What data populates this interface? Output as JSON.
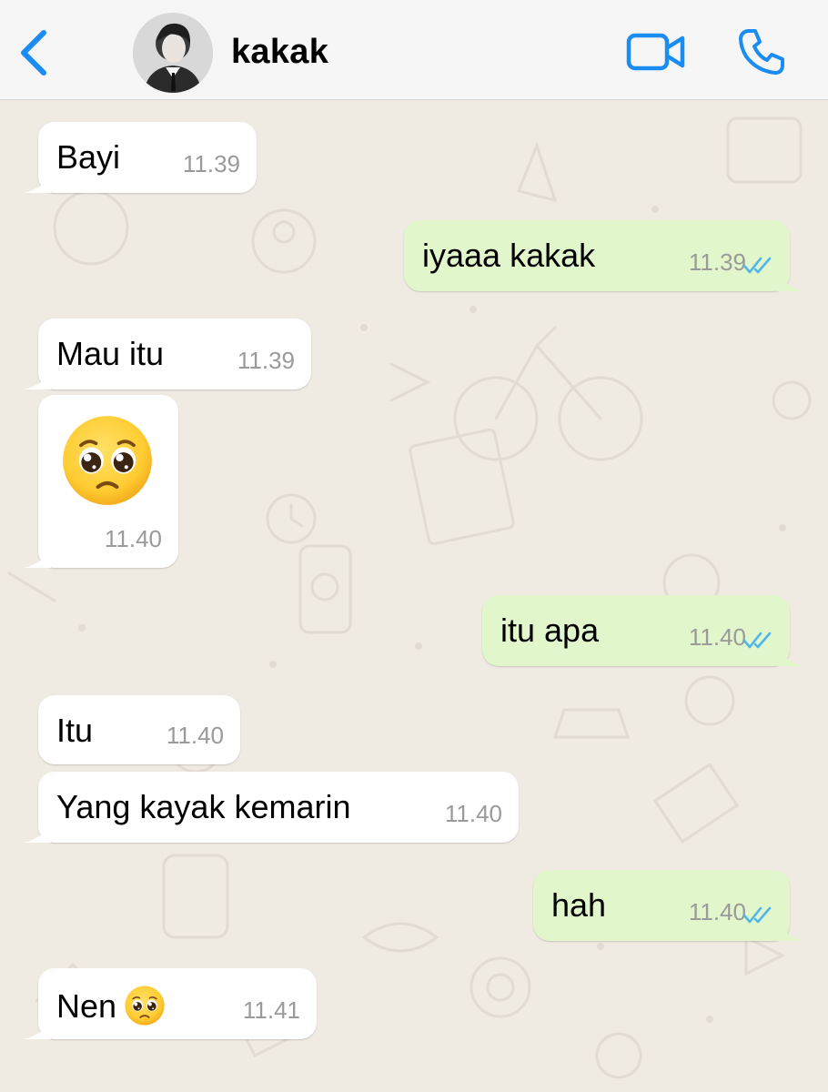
{
  "header": {
    "back_icon": "chevron-left-icon",
    "contact_name": "kakak",
    "video_icon": "video-camera-icon",
    "call_icon": "phone-icon",
    "accent_color": "#1b8cf2"
  },
  "messages": [
    {
      "direction": "incoming",
      "text": "Bayi",
      "time": "11.39"
    },
    {
      "direction": "outgoing",
      "text": "iyaaa kakak",
      "time": "11.39",
      "status": "read"
    },
    {
      "direction": "incoming",
      "text": "Mau itu",
      "time": "11.39"
    },
    {
      "direction": "incoming",
      "emoji": "pleading-face-icon",
      "time": "11.40"
    },
    {
      "direction": "outgoing",
      "text": "itu apa",
      "time": "11.40",
      "status": "read"
    },
    {
      "direction": "incoming",
      "text": "Itu",
      "time": "11.40"
    },
    {
      "direction": "incoming",
      "text": "Yang kayak kemarin",
      "time": "11.40"
    },
    {
      "direction": "outgoing",
      "text": "hah",
      "time": "11.40",
      "status": "read"
    },
    {
      "direction": "incoming",
      "text": "Nen",
      "emoji": "pleading-face-icon",
      "time": "11.41"
    }
  ],
  "colors": {
    "incoming_bubble": "#ffffff",
    "outgoing_bubble": "#e1f6cb",
    "chat_background": "#efeae2",
    "read_ticks": "#4fb6ec"
  }
}
